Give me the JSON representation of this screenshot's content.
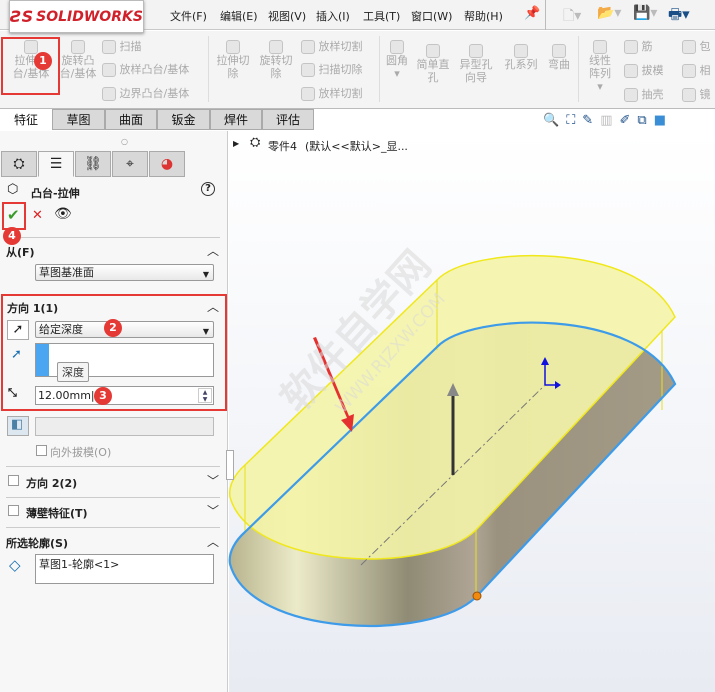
{
  "app": {
    "logo": "SOLIDWORKS",
    "menus": [
      "文件(F)",
      "编辑(E)",
      "视图(V)",
      "插入(I)",
      "工具(T)",
      "窗口(W)",
      "帮助(H)"
    ]
  },
  "ribbon": {
    "extrude_boss": "拉伸凸台/基体",
    "revolve_boss": "旋转凸台/基体",
    "sweep": "扫描",
    "loft_boss": "放样凸台/基体",
    "boundary_boss": "边界凸台/基体",
    "extrude_cut": "拉伸切除",
    "revolve_cut": "旋转切除",
    "loft_cut": "放样切割",
    "sweep_cut": "扫描切除",
    "boundary_cut": "放样切割",
    "fillet": "圆角",
    "simple_hole": "简单直孔",
    "hole_wizard": "异型孔向导",
    "hole_series": "孔系列",
    "flex": "弯曲",
    "linear_pattern": "线性阵列",
    "rib": "筋",
    "draft": "拔模",
    "shell": "抽壳",
    "wrap": "包",
    "intersect": "相",
    "mirror": "镜"
  },
  "tabs": [
    "特征",
    "草图",
    "曲面",
    "钣金",
    "焊件",
    "评估"
  ],
  "tree": {
    "part": "零件4",
    "config": "(默认<<默认>_显..."
  },
  "property_manager": {
    "title": "凸台-拉伸",
    "from": {
      "label": "从(F)",
      "value": "草图基准面"
    },
    "direction1": {
      "label": "方向 1(1)",
      "end_condition": "给定深度",
      "tooltip": "深度",
      "depth": "12.00mm",
      "draft_outward": "向外拔模(O)"
    },
    "direction2": {
      "label": "方向 2(2)"
    },
    "thin": {
      "label": "薄壁特征(T)"
    },
    "contours": {
      "label": "所选轮廓(S)",
      "value": "草图1-轮廓<1>"
    }
  },
  "annotations": {
    "badges": [
      "1",
      "2",
      "3",
      "4"
    ]
  },
  "watermark": {
    "line1": "软件自学网",
    "line2": "WWW.RJZXW.COM"
  },
  "colors": {
    "accent_red": "#e53935",
    "face_yellow": "#f4f4a8",
    "edge_blue": "#3d9be9"
  }
}
